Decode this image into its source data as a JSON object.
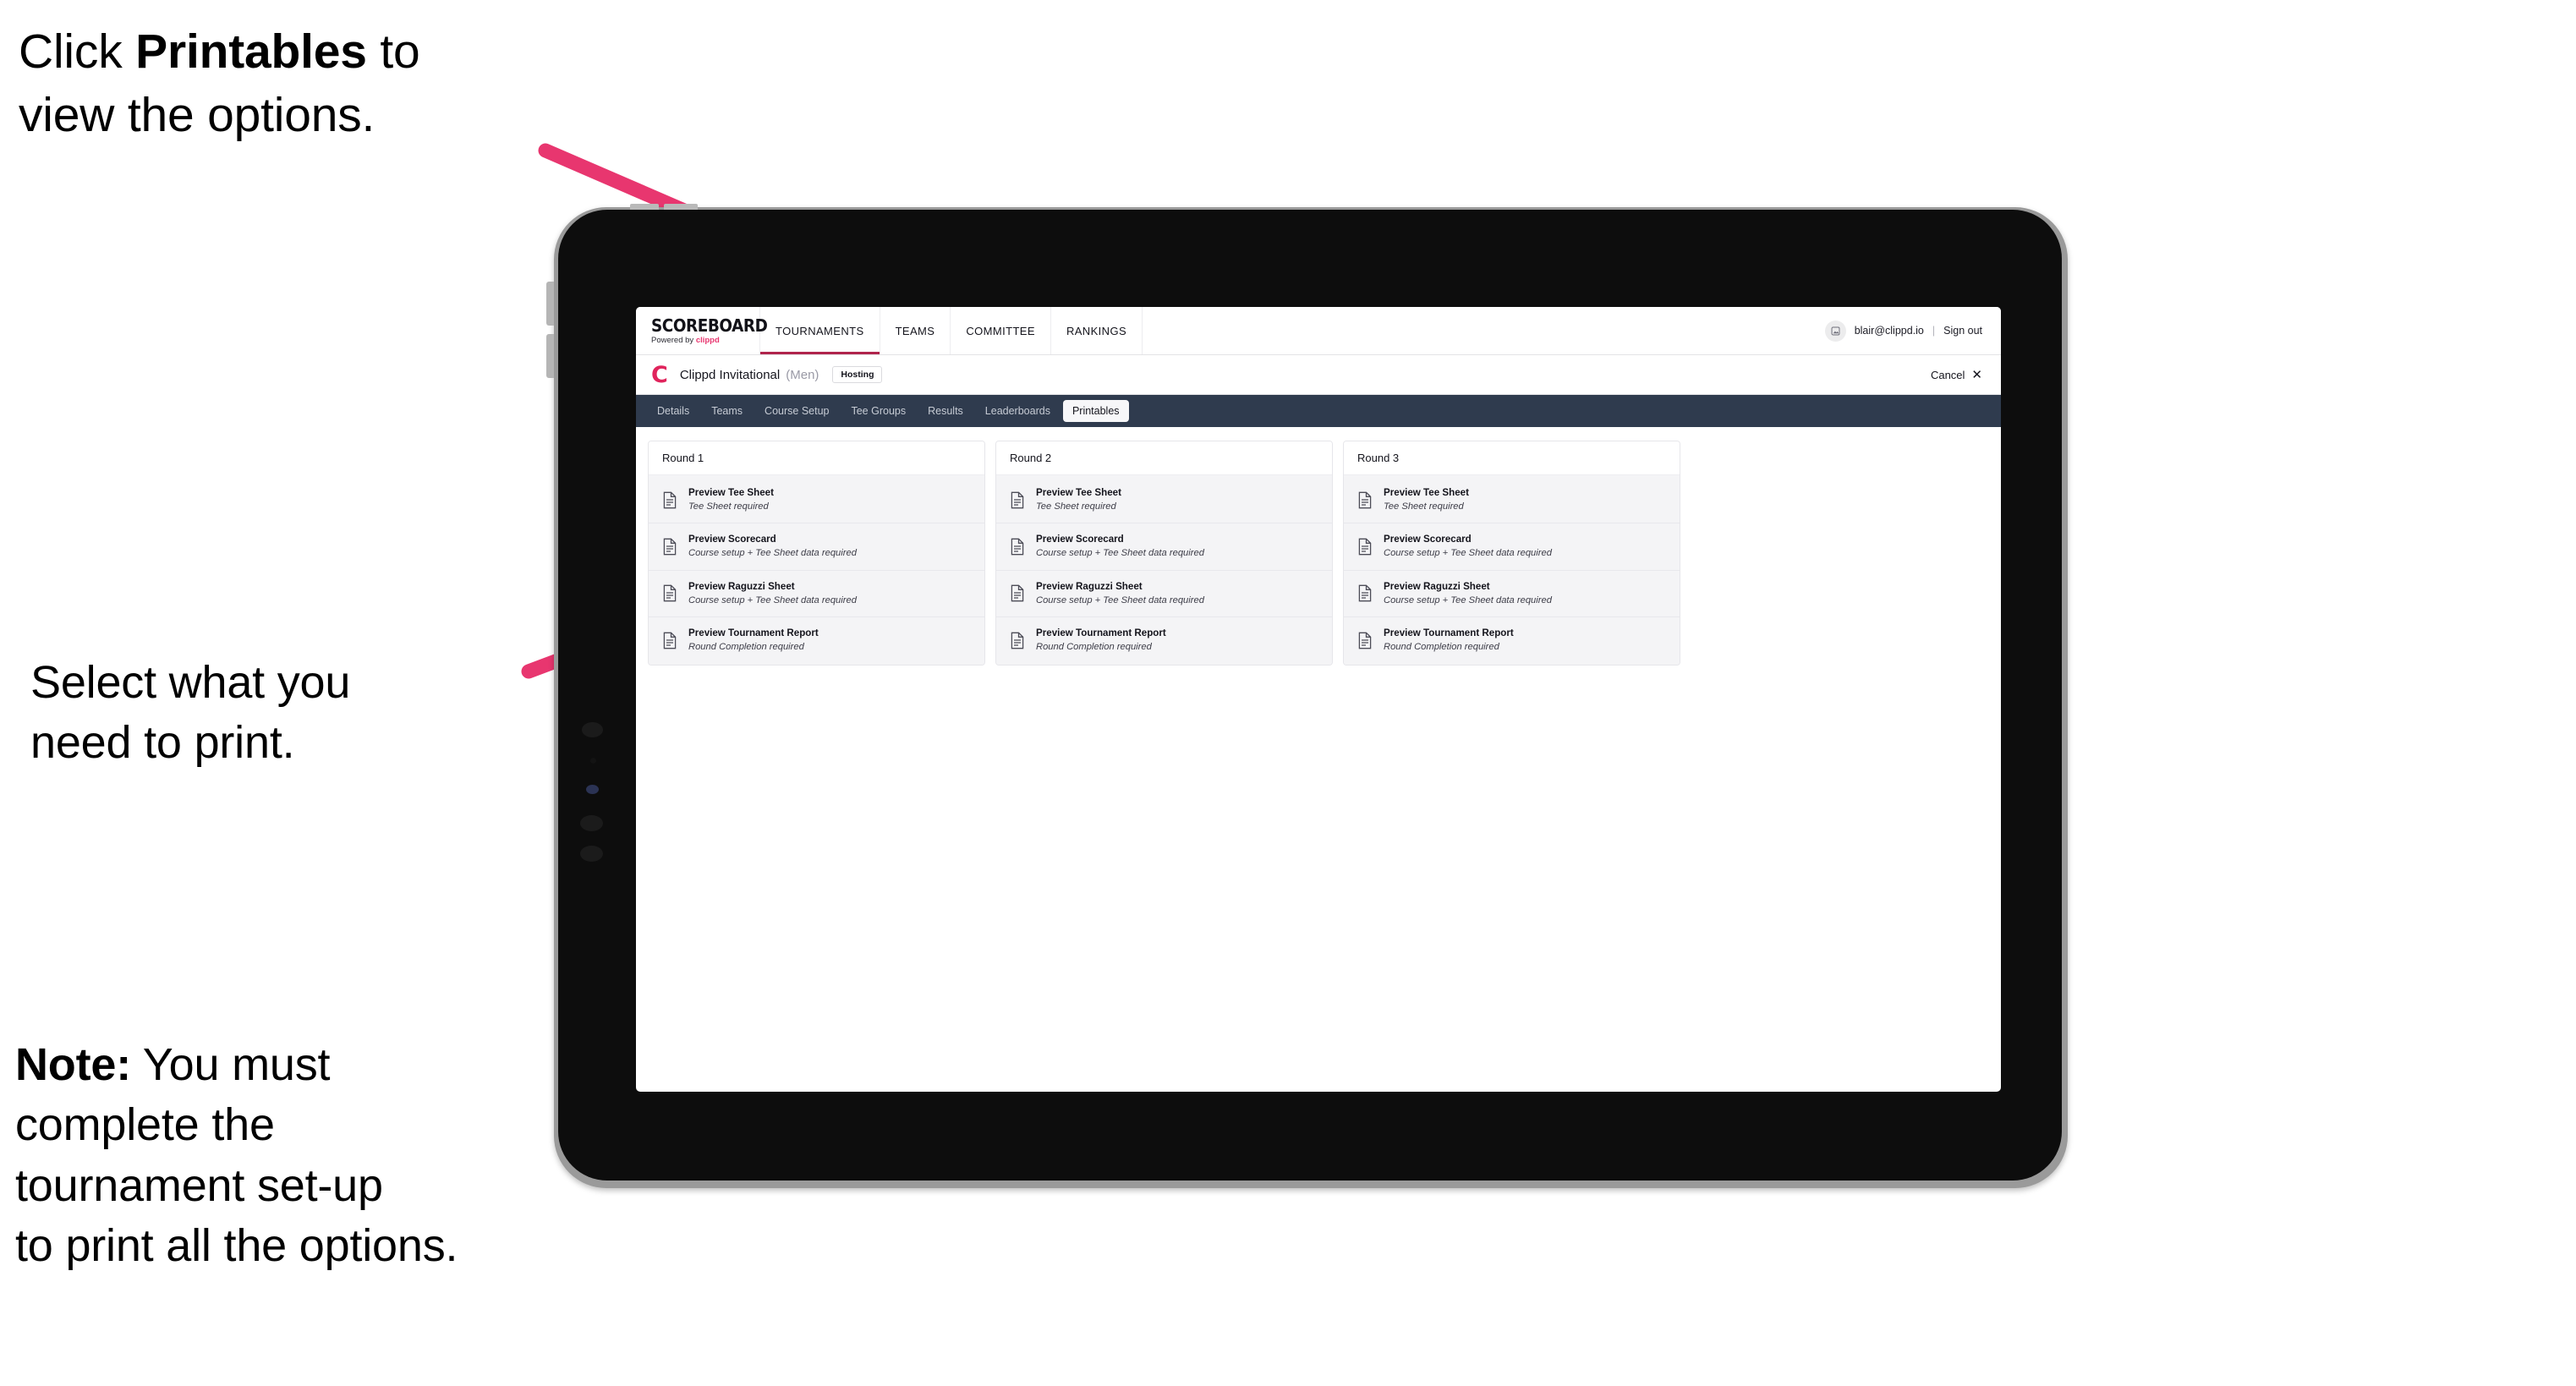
{
  "annotations": {
    "click_printables": {
      "prefix": "Click ",
      "bold": "Printables",
      "suffix": " to\nview the options."
    },
    "select_print": "Select what you\n need to print.",
    "note": {
      "bold": "Note:",
      "text": " You must\ncomplete the\ntournament set-up\nto print all the options."
    }
  },
  "colors": {
    "accent_pink": "#e8366f",
    "arrow_pink": "#e8366f",
    "tab_strip_bg": "#2f3b4e",
    "brand_red": "#e0245c",
    "nav_underline": "#b0244c",
    "card_bg": "#f4f4f6"
  },
  "app": {
    "header": {
      "logo": {
        "wordmark": "SCOREBOARD",
        "powered_prefix": "Powered by ",
        "powered_brand": "clippd"
      },
      "nav": [
        {
          "label": "TOURNAMENTS",
          "active": true
        },
        {
          "label": "TEAMS",
          "active": false
        },
        {
          "label": "COMMITTEE",
          "active": false
        },
        {
          "label": "RANKINGS",
          "active": false
        }
      ],
      "account": {
        "avatar_icon": "user-avatar-icon",
        "email": "blair@clippd.io",
        "separator": "|",
        "sign_out": "Sign out"
      }
    },
    "tournament_bar": {
      "logo_letter": "C",
      "name": "Clippd Invitational",
      "gender": "(Men)",
      "status_badge": "Hosting",
      "cancel_label": "Cancel",
      "cancel_icon": "close-icon"
    },
    "tabs": [
      {
        "label": "Details",
        "active": false
      },
      {
        "label": "Teams",
        "active": false
      },
      {
        "label": "Course Setup",
        "active": false
      },
      {
        "label": "Tee Groups",
        "active": false
      },
      {
        "label": "Results",
        "active": false
      },
      {
        "label": "Leaderboards",
        "active": false
      },
      {
        "label": "Printables",
        "active": true
      }
    ],
    "rounds": [
      {
        "title": "Round 1",
        "items": [
          {
            "title": "Preview Tee Sheet",
            "subtitle": "Tee Sheet required",
            "icon": "document-icon"
          },
          {
            "title": "Preview Scorecard",
            "subtitle": "Course setup + Tee Sheet data required",
            "icon": "document-icon"
          },
          {
            "title": "Preview Raguzzi Sheet",
            "subtitle": "Course setup + Tee Sheet data required",
            "icon": "document-icon"
          },
          {
            "title": "Preview Tournament Report",
            "subtitle": "Round Completion required",
            "icon": "document-icon"
          }
        ]
      },
      {
        "title": "Round 2",
        "items": [
          {
            "title": "Preview Tee Sheet",
            "subtitle": "Tee Sheet required",
            "icon": "document-icon"
          },
          {
            "title": "Preview Scorecard",
            "subtitle": "Course setup + Tee Sheet data required",
            "icon": "document-icon"
          },
          {
            "title": "Preview Raguzzi Sheet",
            "subtitle": "Course setup + Tee Sheet data required",
            "icon": "document-icon"
          },
          {
            "title": "Preview Tournament Report",
            "subtitle": "Round Completion required",
            "icon": "document-icon"
          }
        ]
      },
      {
        "title": "Round 3",
        "items": [
          {
            "title": "Preview Tee Sheet",
            "subtitle": "Tee Sheet required",
            "icon": "document-icon"
          },
          {
            "title": "Preview Scorecard",
            "subtitle": "Course setup + Tee Sheet data required",
            "icon": "document-icon"
          },
          {
            "title": "Preview Raguzzi Sheet",
            "subtitle": "Course setup + Tee Sheet data required",
            "icon": "document-icon"
          },
          {
            "title": "Preview Tournament Report",
            "subtitle": "Round Completion required",
            "icon": "document-icon"
          }
        ]
      }
    ]
  }
}
